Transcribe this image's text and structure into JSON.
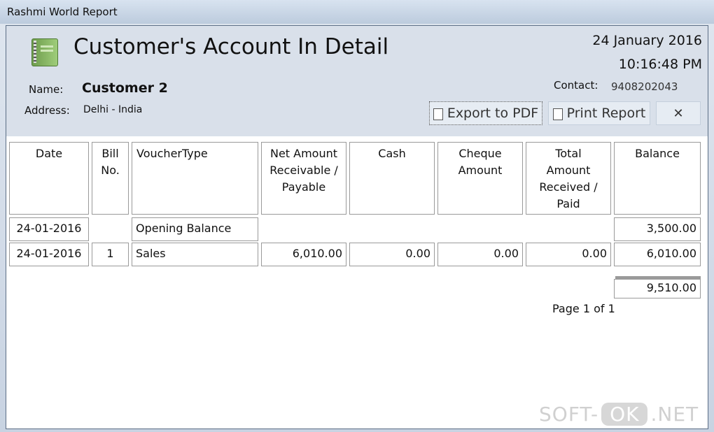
{
  "window": {
    "title": "Rashmi World Report"
  },
  "report": {
    "title": "Customer's Account In Detail",
    "date": "24 January 2016",
    "time": "10:16:48 PM",
    "name_label": "Name:",
    "name_value": "Customer 2",
    "address_label": "Address:",
    "address_value": "Delhi - India",
    "contact_label": "Contact:",
    "contact_value": "9408202043"
  },
  "toolbar": {
    "export_label": "Export to PDF",
    "print_label": "Print Report",
    "close_label": "✕"
  },
  "table": {
    "headers": [
      "Date",
      "Bill\nNo.",
      "VoucherType",
      "Net Amount\nReceivable /\nPayable",
      "Cash",
      "Cheque\nAmount",
      "Total\nAmount\nReceived /\nPaid",
      "Balance"
    ],
    "opening": {
      "date": "24-01-2016",
      "voucher": "Opening Balance",
      "balance": "3,500.00"
    },
    "rows": [
      {
        "date": "24-01-2016",
        "bill": "1",
        "voucher": "Sales",
        "net": "6,010.00",
        "cash": "0.00",
        "cheque": "0.00",
        "total": "0.00",
        "balance": "6,010.00"
      }
    ],
    "grand_total": "9,510.00"
  },
  "footer": {
    "page": "Page 1 of 1"
  },
  "watermark": {
    "left": "SOFT-",
    "ok": "OK",
    "right": ".NET"
  }
}
